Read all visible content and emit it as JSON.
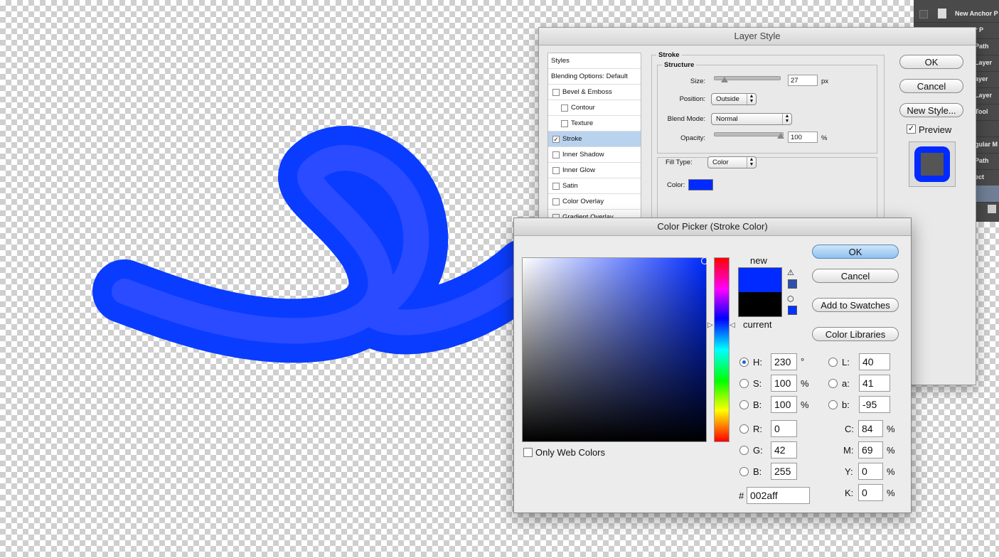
{
  "history_panel": {
    "items": [
      "New Anchor P",
      "Anchor P",
      "Path",
      "Layer",
      "ayer",
      "Layer",
      "Tool",
      "",
      "gular M",
      "Path",
      "ect"
    ]
  },
  "layer_style": {
    "title": "Layer Style",
    "styles_header": "Styles",
    "blending_options": "Blending Options: Default",
    "effects": [
      {
        "label": "Bevel & Emboss",
        "checked": false
      },
      {
        "label": "Contour",
        "checked": false
      },
      {
        "label": "Texture",
        "checked": false
      },
      {
        "label": "Stroke",
        "checked": true
      },
      {
        "label": "Inner Shadow",
        "checked": false
      },
      {
        "label": "Inner Glow",
        "checked": false
      },
      {
        "label": "Satin",
        "checked": false
      },
      {
        "label": "Color Overlay",
        "checked": false
      },
      {
        "label": "Gradient Overlay",
        "checked": false
      }
    ],
    "stroke_title": "Stroke",
    "structure_title": "Structure",
    "size_label": "Size:",
    "size_value": "27",
    "size_unit": "px",
    "position_label": "Position:",
    "position_value": "Outside",
    "blend_mode_label": "Blend Mode:",
    "blend_mode_value": "Normal",
    "opacity_label": "Opacity:",
    "opacity_value": "100",
    "opacity_unit": "%",
    "fill_type_label": "Fill Type:",
    "fill_type_value": "Color",
    "color_label": "Color:",
    "stroke_color": "#002aff",
    "ok": "OK",
    "cancel": "Cancel",
    "new_style": "New Style...",
    "preview_label": "Preview",
    "preview_checked": true
  },
  "color_picker": {
    "title": "Color Picker (Stroke Color)",
    "new_label": "new",
    "current_label": "current",
    "new_color": "#002aff",
    "current_color": "#000000",
    "ok": "OK",
    "cancel": "Cancel",
    "add_to_swatches": "Add to Swatches",
    "color_libraries": "Color Libraries",
    "only_web_colors": "Only Web Colors",
    "H": {
      "label": "H:",
      "value": "230",
      "unit": "°"
    },
    "S": {
      "label": "S:",
      "value": "100",
      "unit": "%"
    },
    "Bv": {
      "label": "B:",
      "value": "100",
      "unit": "%"
    },
    "R": {
      "label": "R:",
      "value": "0"
    },
    "G": {
      "label": "G:",
      "value": "42"
    },
    "B2": {
      "label": "B:",
      "value": "255"
    },
    "L": {
      "label": "L:",
      "value": "40"
    },
    "a": {
      "label": "a:",
      "value": "41"
    },
    "b": {
      "label": "b:",
      "value": "-95"
    },
    "C": {
      "label": "C:",
      "value": "84",
      "unit": "%"
    },
    "M": {
      "label": "M:",
      "value": "69",
      "unit": "%"
    },
    "Y": {
      "label": "Y:",
      "value": "0",
      "unit": "%"
    },
    "K": {
      "label": "K:",
      "value": "0",
      "unit": "%"
    },
    "hash": "#",
    "hex": "002aff"
  },
  "canvas": {
    "stroke_outer_color": "#0a3cff",
    "stroke_inner_color": "#2a4bff"
  }
}
